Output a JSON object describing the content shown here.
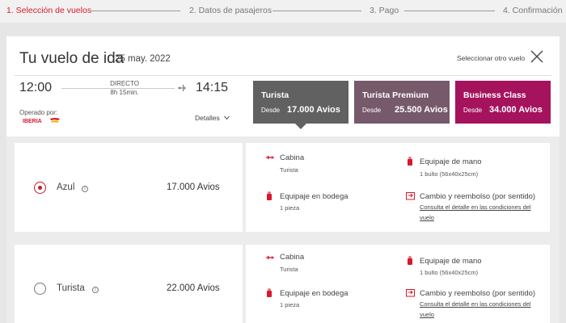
{
  "stepper": {
    "steps": [
      {
        "label": "1. Selección de vuelos",
        "active": true
      },
      {
        "label": "2. Datos de pasajeros",
        "active": false
      },
      {
        "label": "3. Pago",
        "active": false
      },
      {
        "label": "4. Confirmación",
        "active": false
      }
    ]
  },
  "flight": {
    "title": "Tu vuelo de ida",
    "date": "25 may. 2022",
    "select_other": "Seleccionar otro vuelo",
    "departure_time": "12:00",
    "arrival_time": "14:15",
    "type": "DIRECTO",
    "duration": "8h 15min.",
    "operated_by": "Operado por:",
    "carrier": "IBERIA",
    "details": "Detalles"
  },
  "fares": [
    {
      "name": "Turista",
      "from": "Desde",
      "price": "17.000 Avios",
      "color": "#616161",
      "selected": true
    },
    {
      "name": "Turista Premium",
      "from": "Desde",
      "price": "25.500 Avios",
      "color": "#76596b",
      "selected": false
    },
    {
      "name": "Business Class",
      "from": "Desde",
      "price": "34.000 Avios",
      "color": "#a5135d",
      "selected": false
    }
  ],
  "options": [
    {
      "name": "Azul",
      "price": "17.000 Avios",
      "selected": true,
      "features": {
        "cabin": {
          "title": "Cabina",
          "value": "Turista"
        },
        "hand_luggage": {
          "title": "Equipaje de mano",
          "value": "1 bulto (56x40x25cm)"
        },
        "hold_luggage": {
          "title": "Equipaje en bodega",
          "value": "1 pieza"
        },
        "change": {
          "title": "Cambio y reembolso (por sentido)",
          "link_line1": "Consulta el detalle en las condiciones del",
          "link_line2": "vuelo"
        }
      }
    },
    {
      "name": "Turista",
      "price": "22.000 Avios",
      "selected": false,
      "features": {
        "cabin": {
          "title": "Cabina",
          "value": "Turista"
        },
        "hand_luggage": {
          "title": "Equipaje de mano",
          "value": "1 bulto (56x40x25cm)"
        },
        "hold_luggage": {
          "title": "Equipaje en bodega",
          "value": "1 pieza"
        },
        "change": {
          "title": "Cambio y reembolso (por sentido)",
          "link_line1": "Consulta el detalle en las condiciones del",
          "link_line2": "vuelo"
        }
      }
    }
  ],
  "colors": {
    "accent": "#d7192d",
    "selected_radio": "#c11c2c"
  },
  "icons": [
    "close-icon",
    "plane-icon",
    "chevron-down-icon",
    "info-icon",
    "seat-icon",
    "hand-luggage-icon",
    "suitcase-icon",
    "exchange-icon"
  ]
}
